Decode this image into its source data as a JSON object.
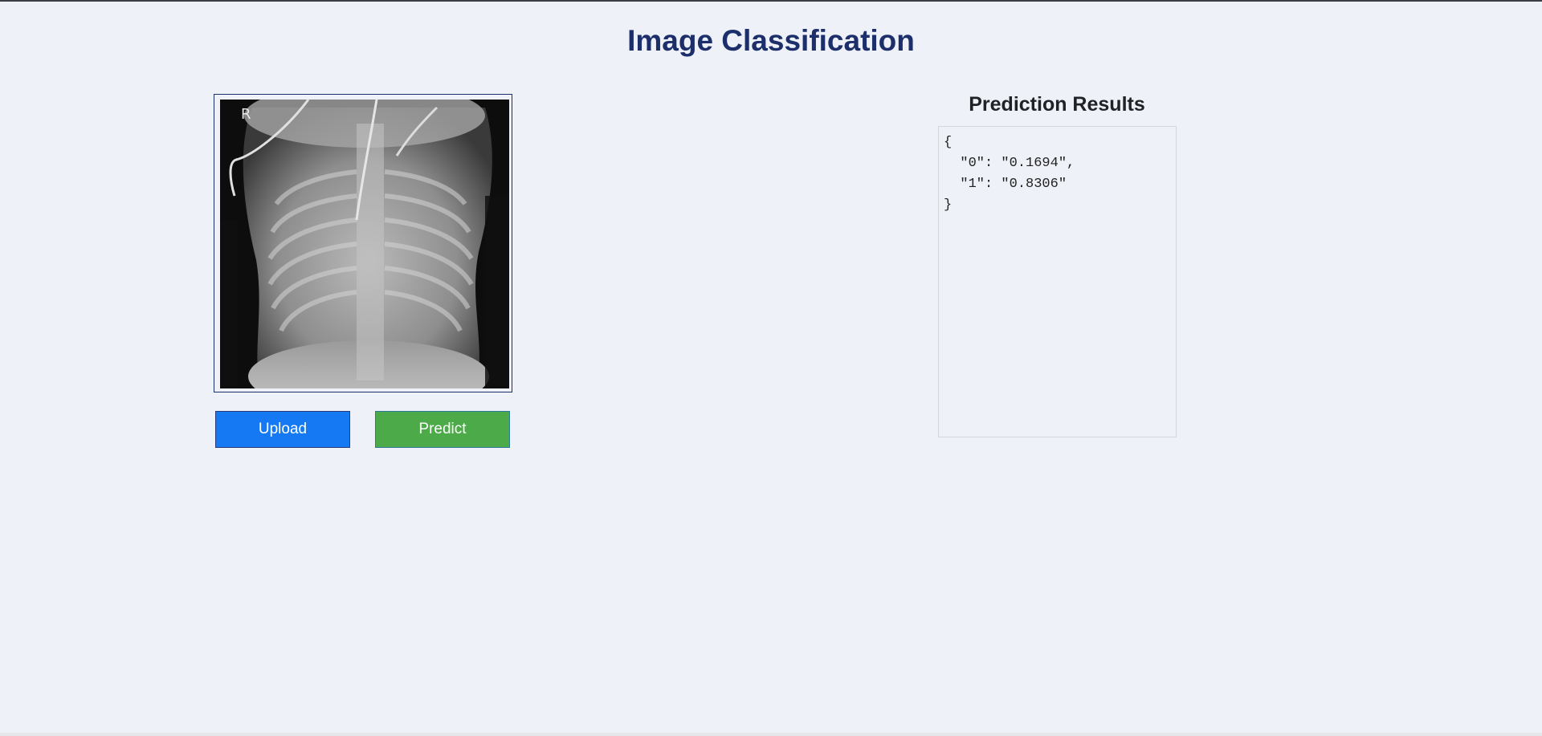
{
  "page": {
    "title": "Image Classification"
  },
  "image_panel": {
    "image_label": "R",
    "upload_label": "Upload",
    "predict_label": "Predict"
  },
  "results": {
    "heading": "Prediction Results",
    "json_text": "{\n  \"0\": \"0.1694\",\n  \"1\": \"0.8306\"\n}"
  },
  "colors": {
    "title": "#1d2f6b",
    "upload_button": "#1479f2",
    "predict_button": "#4caa48",
    "background": "#eef1f8"
  }
}
